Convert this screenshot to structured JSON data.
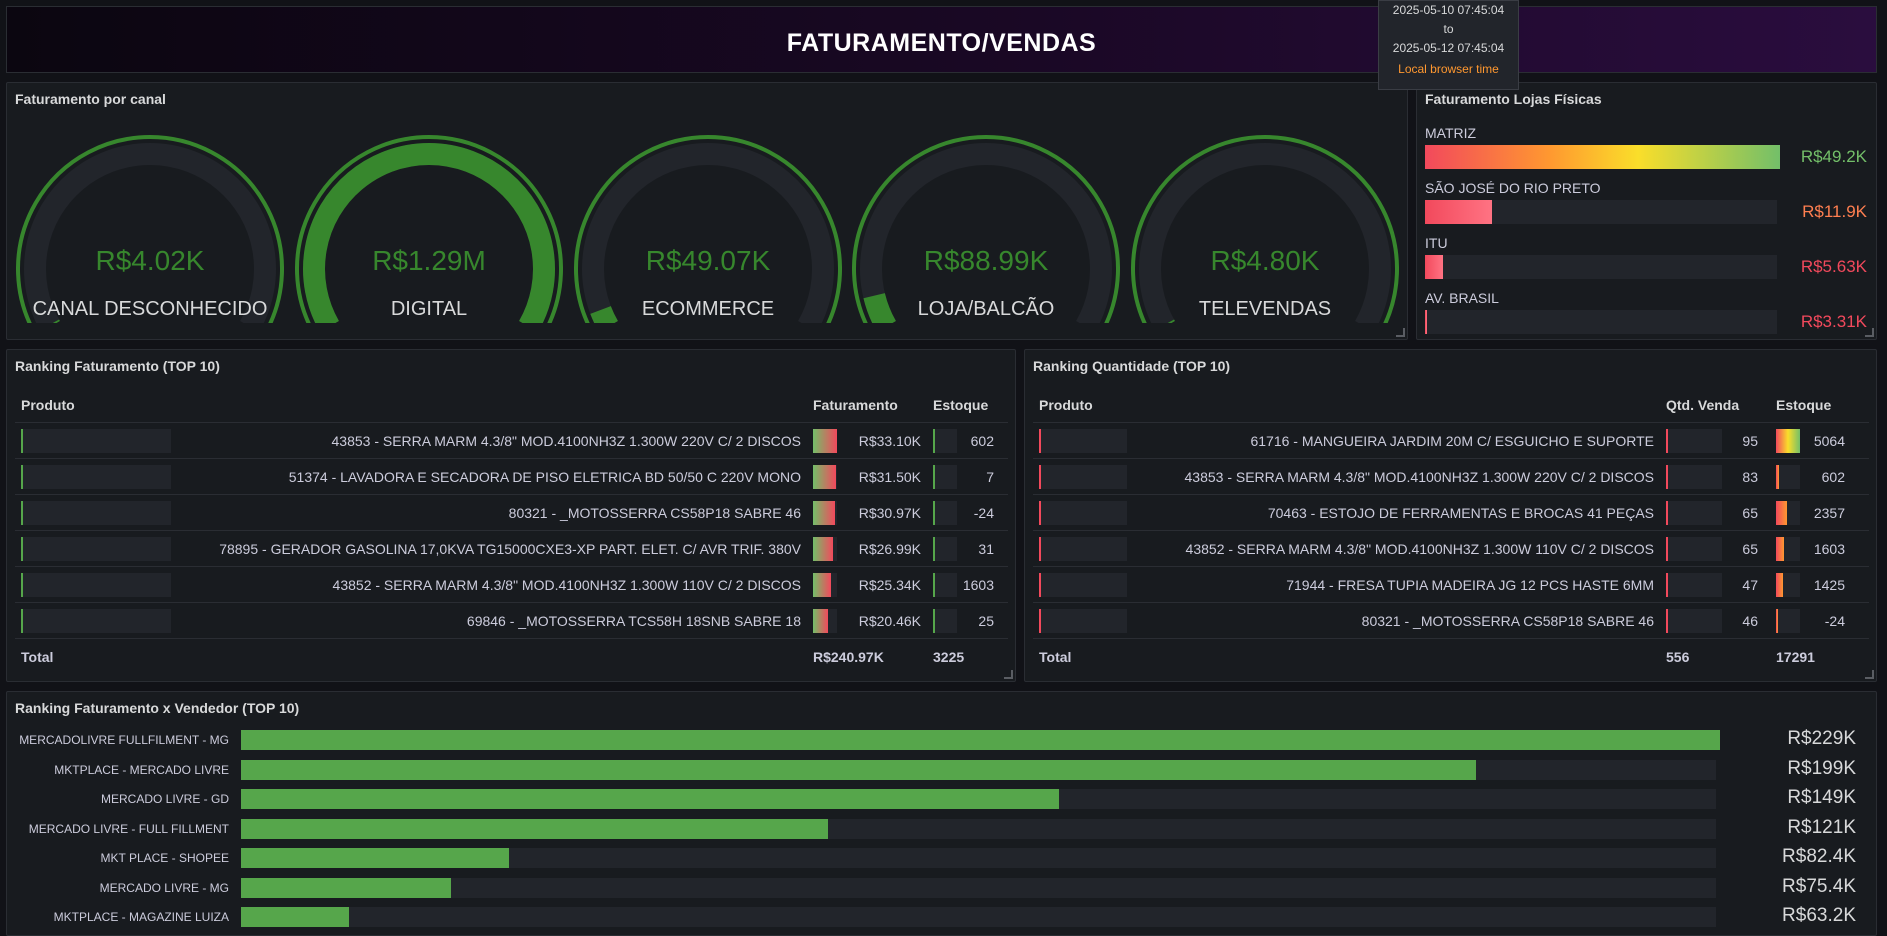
{
  "header": {
    "title": "FATURAMENTO/VENDAS",
    "time_from": "2025-05-10 07:45:04",
    "time_to_word": "to",
    "time_to": "2025-05-12 07:45:04",
    "timezone": "Local browser time"
  },
  "canal": {
    "title": "Faturamento por canal",
    "gauges": [
      {
        "label": "CANAL DESCONHECIDO",
        "value": "R$4.02K",
        "fraction": 0.003
      },
      {
        "label": "DIGITAL",
        "value": "R$1.29M",
        "fraction": 1.0
      },
      {
        "label": "ECOMMERCE",
        "value": "R$49.07K",
        "fraction": 0.038
      },
      {
        "label": "LOJA/BALCÃO",
        "value": "R$88.99K",
        "fraction": 0.069
      },
      {
        "label": "TELEVENDAS",
        "value": "R$4.80K",
        "fraction": 0.004
      }
    ],
    "color": "#37872d"
  },
  "lojas": {
    "title": "Faturamento Lojas Físicas",
    "items": [
      {
        "name": "MATRIZ",
        "value": "R$49.2K",
        "fraction": 1.0,
        "color": "#73bf69"
      },
      {
        "name": "SÃO JOSÉ DO RIO PRETO",
        "value": "R$11.9K",
        "fraction": 0.19,
        "color": "#ff7f50"
      },
      {
        "name": "ITU",
        "value": "R$5.63K",
        "fraction": 0.05,
        "color": "#f2495c"
      },
      {
        "name": "AV. BRASIL",
        "value": "R$3.31K",
        "fraction": 0.005,
        "color": "#f2495c"
      }
    ]
  },
  "ranking_fat": {
    "title": "Ranking Faturamento (TOP 10)",
    "headers": [
      "Produto",
      "Faturamento",
      "Estoque"
    ],
    "rows": [
      {
        "produto": "43853 - SERRA MARM 4.3/8\" MOD.4100NH3Z 1.300W 220V C/ 2 DISCOS",
        "faturamento": "R$33.10K",
        "estoque": "602",
        "fat_frac": 1.0,
        "est_frac": 0.0
      },
      {
        "produto": "51374 - LAVADORA E SECADORA DE PISO ELETRICA BD 50/50 C 220V MONO",
        "faturamento": "R$31.50K",
        "estoque": "7",
        "fat_frac": 0.95,
        "est_frac": 0.0
      },
      {
        "produto": "80321 - _MOTOSSERRA CS58P18 SABRE 46",
        "faturamento": "R$30.97K",
        "estoque": "-24",
        "fat_frac": 0.93,
        "est_frac": 0.0
      },
      {
        "produto": "78895 - GERADOR GASOLINA 17,0KVA TG15000CXE3-XP PART. ELET. C/ AVR TRIF. 380V",
        "faturamento": "R$26.99K",
        "estoque": "31",
        "fat_frac": 0.82,
        "est_frac": 0.0
      },
      {
        "produto": "43852 - SERRA MARM 4.3/8\" MOD.4100NH3Z 1.300W 110V C/ 2 DISCOS",
        "faturamento": "R$25.34K",
        "estoque": "1603",
        "fat_frac": 0.77,
        "est_frac": 0.0
      },
      {
        "produto": "69846 - _MOTOSSERRA TCS58H 18SNB SABRE 18",
        "faturamento": "R$20.46K",
        "estoque": "25",
        "fat_frac": 0.62,
        "est_frac": 0.0
      }
    ],
    "total_label": "Total",
    "total_fat": "R$240.97K",
    "total_est": "3225"
  },
  "ranking_qtd": {
    "title": "Ranking Quantidade (TOP 10)",
    "headers": [
      "Produto",
      "Qtd. Venda",
      "Estoque"
    ],
    "rows": [
      {
        "produto": "61716 - MANGUEIRA JARDIM 20M C/ ESGUICHO E SUPORTE",
        "qtd": "95",
        "estoque": "5064",
        "est_frac": 1.0
      },
      {
        "produto": "43853 - SERRA MARM 4.3/8\" MOD.4100NH3Z 1.300W 220V C/ 2 DISCOS",
        "qtd": "83",
        "estoque": "602",
        "est_frac": 0.12
      },
      {
        "produto": "70463 - ESTOJO DE FERRAMENTAS E BROCAS 41 PEÇAS",
        "qtd": "65",
        "estoque": "2357",
        "est_frac": 0.47
      },
      {
        "produto": "43852 - SERRA MARM 4.3/8\" MOD.4100NH3Z 1.300W 110V C/ 2 DISCOS",
        "qtd": "65",
        "estoque": "1603",
        "est_frac": 0.32
      },
      {
        "produto": "71944 - FRESA TUPIA MADEIRA JG 12 PCS HASTE 6MM",
        "qtd": "47",
        "estoque": "1425",
        "est_frac": 0.28
      },
      {
        "produto": "80321 - _MOTOSSERRA CS58P18 SABRE 46",
        "qtd": "46",
        "estoque": "-24",
        "est_frac": 0.0
      }
    ],
    "total_label": "Total",
    "total_qtd": "556",
    "total_est": "17291"
  },
  "vendedor": {
    "title": "Ranking Faturamento x Vendedor (TOP 10)",
    "rows": [
      {
        "name": "MERCADOLIVRE FULLFILMENT - MG",
        "value": "R$229K",
        "fraction": 1.0
      },
      {
        "name": "MKTPLACE - MERCADO LIVRE",
        "value": "R$199K",
        "fraction": 0.835
      },
      {
        "name": "MERCADO LIVRE - GD",
        "value": "R$149K",
        "fraction": 0.553
      },
      {
        "name": "MERCADO LIVRE - FULL FILLMENT",
        "value": "R$121K",
        "fraction": 0.397
      },
      {
        "name": "MKT PLACE - SHOPEE",
        "value": "R$82.4K",
        "fraction": 0.181
      },
      {
        "name": "MERCADO LIVRE - MG",
        "value": "R$75.4K",
        "fraction": 0.142
      },
      {
        "name": "MKTPLACE - MAGAZINE LUIZA",
        "value": "R$63.2K",
        "fraction": 0.073
      }
    ]
  }
}
